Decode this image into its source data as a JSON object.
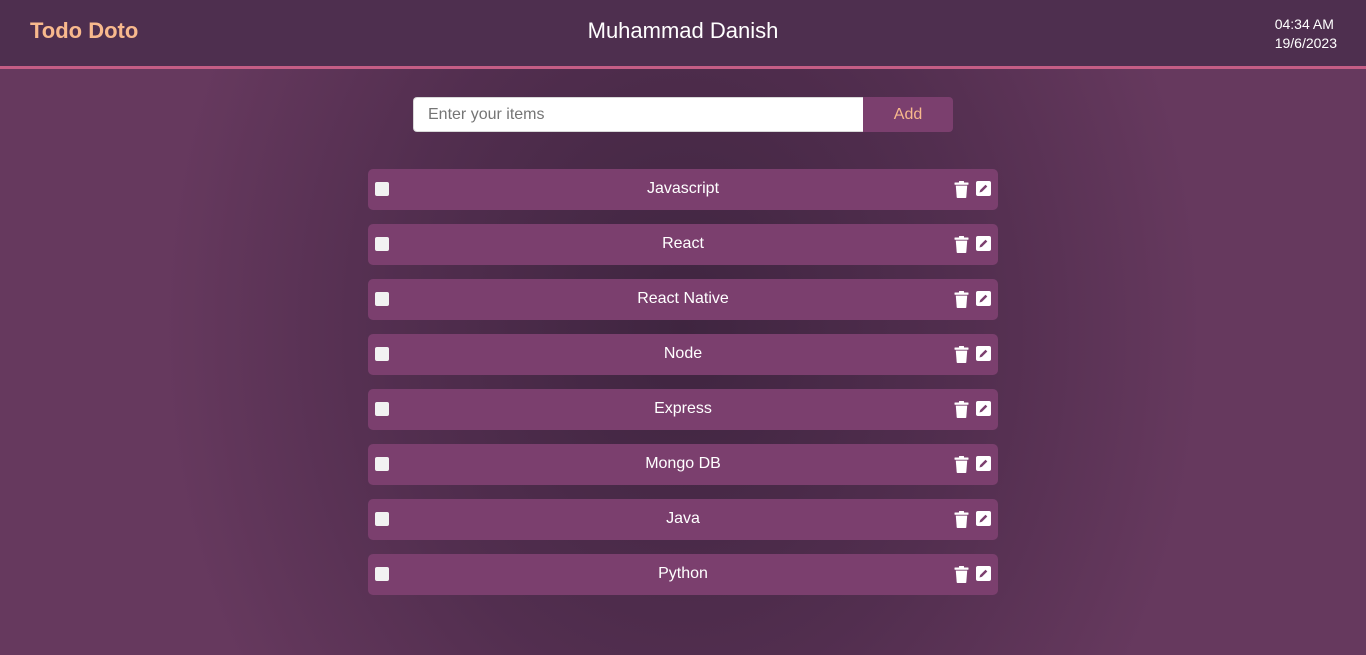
{
  "header": {
    "logo": "Todo Doto",
    "user_name": "Muhammad Danish",
    "time": "04:34 AM",
    "date": "19/6/2023"
  },
  "input": {
    "placeholder": "Enter your items",
    "value": "",
    "add_label": "Add"
  },
  "todos": [
    {
      "label": "Javascript",
      "checked": false
    },
    {
      "label": "React",
      "checked": false
    },
    {
      "label": "React Native",
      "checked": false
    },
    {
      "label": "Node",
      "checked": false
    },
    {
      "label": "Express",
      "checked": false
    },
    {
      "label": "Mongo DB",
      "checked": false
    },
    {
      "label": "Java",
      "checked": false
    },
    {
      "label": "Python",
      "checked": false
    }
  ],
  "icons": {
    "delete": "trash-icon",
    "edit": "edit-icon"
  },
  "colors": {
    "accent": "#f8b98d",
    "header_border": "#c45d85",
    "item_background": "#7b3f6e",
    "header_background": "#4e2f4f"
  }
}
